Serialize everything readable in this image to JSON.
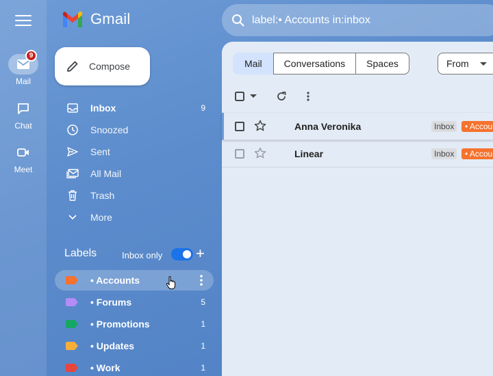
{
  "app": {
    "logo_text": "Gmail"
  },
  "rail": {
    "items": [
      {
        "label": "Mail",
        "badge": "9",
        "icon": "mail-icon"
      },
      {
        "label": "Chat",
        "icon": "chat-icon"
      },
      {
        "label": "Meet",
        "icon": "video-icon"
      }
    ]
  },
  "compose": {
    "label": "Compose"
  },
  "nav": {
    "items": [
      {
        "label": "Inbox",
        "count": "9",
        "icon": "inbox-icon"
      },
      {
        "label": "Snoozed",
        "icon": "clock-icon"
      },
      {
        "label": "Sent",
        "icon": "send-icon"
      },
      {
        "label": "All Mail",
        "icon": "all-mail-icon"
      },
      {
        "label": "Trash",
        "icon": "trash-icon"
      },
      {
        "label": "More",
        "icon": "chevron-down-icon"
      }
    ]
  },
  "labels": {
    "title": "Labels",
    "inbox_only": "Inbox only",
    "toggle_on": true,
    "items": [
      {
        "label": "• Accounts",
        "color": "#f6722d"
      },
      {
        "label": "• Forums",
        "count": "5",
        "color": "#b38cf5"
      },
      {
        "label": "• Promotions",
        "count": "1",
        "color": "#16a765"
      },
      {
        "label": "• Updates",
        "count": "1",
        "color": "#f6ad3c"
      },
      {
        "label": "• Work",
        "count": "1",
        "color": "#e8453c"
      }
    ]
  },
  "search": {
    "query": "label:• Accounts in:inbox"
  },
  "filters": {
    "tabs": [
      {
        "label": "Mail"
      },
      {
        "label": "Conversations"
      },
      {
        "label": "Spaces"
      }
    ],
    "from_label": "From"
  },
  "messages": [
    {
      "sender": "Anna Veronika",
      "tags": [
        "Inbox",
        "• Accounts"
      ]
    },
    {
      "sender": "Linear",
      "tags": [
        "Inbox",
        "• Accounts"
      ]
    }
  ]
}
